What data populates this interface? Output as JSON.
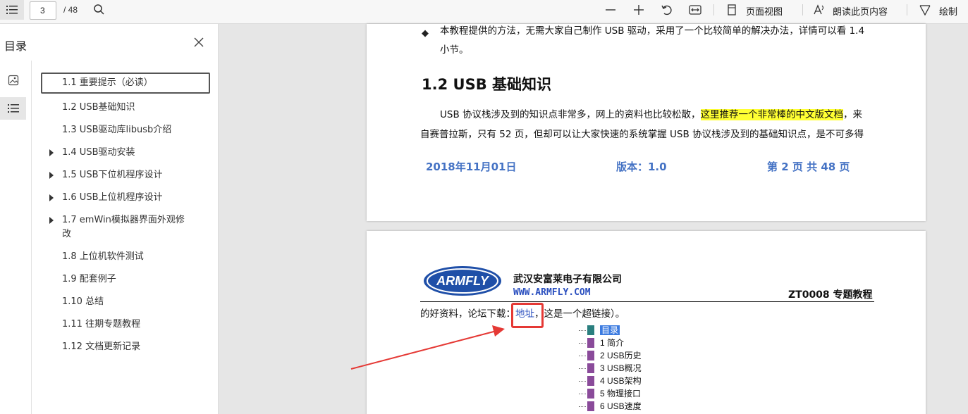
{
  "toolbar": {
    "page_current": "3",
    "page_total": "/ 48",
    "page_view_label": "页面视图",
    "read_aloud_label": "朗读此页内容",
    "draw_label": "绘制"
  },
  "sidebar": {
    "title": "目录",
    "toc": [
      {
        "label": "1.1 重要提示（必读）",
        "expandable": false
      },
      {
        "label": "1.2 USB基础知识",
        "expandable": false
      },
      {
        "label": "1.3 USB驱动库libusb介绍",
        "expandable": false
      },
      {
        "label": "1.4 USB驱动安装",
        "expandable": true
      },
      {
        "label": "1.5 USB下位机程序设计",
        "expandable": true
      },
      {
        "label": "1.6 USB上位机程序设计",
        "expandable": true
      },
      {
        "label": "1.7 emWin模拟器界面外观修",
        "label2": "改",
        "expandable": true
      },
      {
        "label": "1.8 上位机软件测试",
        "expandable": false
      },
      {
        "label": "1.9 配套例子",
        "expandable": false
      },
      {
        "label": "1.10 总结",
        "expandable": false
      },
      {
        "label": "1.11 往期专题教程",
        "expandable": false
      },
      {
        "label": "1.12 文档更新记录",
        "expandable": false
      }
    ]
  },
  "page1": {
    "bullet_line1": "本教程提供的方法，无需大家自己制作 USB 驱动，采用了一个比较简单的解决办法，详情可以看 1.4",
    "bullet_line2": "小节。",
    "heading": "1.2 USB 基础知识",
    "para_line1_a": "USB 协议栈涉及到的知识点非常多，网上的资料也比较松散，",
    "para_line1_hl": "这里推荐一个非常棒的中文版文档",
    "para_line1_b": "，来",
    "para_line2": "自赛普拉斯，只有 52 页，但却可以让大家快速的系统掌握 USB 协议栈涉及到的基础知识点，是不可多得",
    "footer_date": "2018年11月01日",
    "footer_version": "版本：1.0",
    "footer_page": "第 2 页   共 48 页"
  },
  "page2": {
    "logo_text": "ARMFLY",
    "company": "武汉安富莱电子有限公司",
    "website": "WWW.ARMFLY.COM",
    "doc_code": "ZT0008 专题教程",
    "line_a": "的好资料，论坛下载：",
    "link": "地址",
    "line_b": "，这是一个超链接）。",
    "bookmarks": [
      "目录",
      "1 简介",
      "2 USB历史",
      "3 USB概况",
      "4 USB架构",
      "5 物理接口",
      "6 USB速度"
    ]
  },
  "colors": {
    "highlight": "#ffff33",
    "footer_blue": "#4472c4",
    "link_blue": "#2a4fbf",
    "annotation_red": "#e53935"
  }
}
